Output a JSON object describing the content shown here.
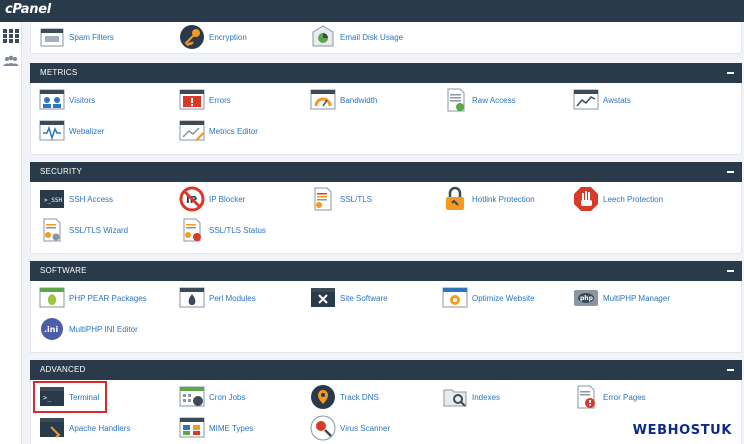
{
  "app": {
    "logo_text": "cPanel"
  },
  "sidebar": {
    "items": [
      {
        "icon": "grid-icon",
        "label": ""
      },
      {
        "icon": "users-icon",
        "label": ""
      }
    ]
  },
  "top_row": [
    {
      "label": "Spam Filters",
      "icon": "spam-filter-icon"
    },
    {
      "label": "Encryption",
      "icon": "key-icon"
    },
    {
      "label": "Email Disk Usage",
      "icon": "disk-usage-icon"
    }
  ],
  "panels": [
    {
      "title": "METRICS",
      "rows": [
        [
          {
            "label": "Visitors",
            "icon": "visitors-icon"
          },
          {
            "label": "Errors",
            "icon": "errors-icon"
          },
          {
            "label": "Bandwidth",
            "icon": "bandwidth-icon"
          },
          {
            "label": "Raw Access",
            "icon": "raw-access-icon"
          },
          {
            "label": "Awstats",
            "icon": "awstats-icon"
          }
        ],
        [
          {
            "label": "Webalizer",
            "icon": "webalizer-icon"
          },
          {
            "label": "Metrics Editor",
            "icon": "metrics-editor-icon"
          }
        ]
      ]
    },
    {
      "title": "SECURITY",
      "rows": [
        [
          {
            "label": "SSH Access",
            "icon": "ssh-icon"
          },
          {
            "label": "IP Blocker",
            "icon": "ip-blocker-icon"
          },
          {
            "label": "SSL/TLS",
            "icon": "ssl-icon"
          },
          {
            "label": "Hotlink Protection",
            "icon": "lock-icon"
          },
          {
            "label": "Leech Protection",
            "icon": "stop-hand-icon"
          }
        ],
        [
          {
            "label": "SSL/TLS Wizard",
            "icon": "ssl-wizard-icon"
          },
          {
            "label": "SSL/TLS Status",
            "icon": "ssl-status-icon"
          }
        ]
      ]
    },
    {
      "title": "SOFTWARE",
      "rows": [
        [
          {
            "label": "PHP PEAR Packages",
            "icon": "php-pear-icon"
          },
          {
            "label": "Perl Modules",
            "icon": "perl-icon"
          },
          {
            "label": "Site Software",
            "icon": "site-software-icon"
          },
          {
            "label": "Optimize Website",
            "icon": "optimize-icon"
          },
          {
            "label": "MultiPHP Manager",
            "icon": "multiphp-manager-icon"
          }
        ],
        [
          {
            "label": "MultiPHP INI Editor",
            "icon": "ini-editor-icon"
          }
        ]
      ]
    },
    {
      "title": "ADVANCED",
      "rows": [
        [
          {
            "label": "Terminal",
            "icon": "terminal-icon"
          },
          {
            "label": "Cron Jobs",
            "icon": "cron-icon"
          },
          {
            "label": "Track DNS",
            "icon": "track-dns-icon"
          },
          {
            "label": "Indexes",
            "icon": "indexes-icon"
          },
          {
            "label": "Error Pages",
            "icon": "error-pages-icon"
          }
        ],
        [
          {
            "label": "Apache Handlers",
            "icon": "apache-handlers-icon"
          },
          {
            "label": "MIME Types",
            "icon": "mime-types-icon"
          },
          {
            "label": "Virus Scanner",
            "icon": "virus-scanner-icon"
          }
        ]
      ]
    }
  ],
  "highlighted_item": "Terminal",
  "watermark": "WEBHOSTUK",
  "colors": {
    "header": "#293a4a",
    "link": "#2b76c0",
    "highlight": "#d92a2a"
  }
}
